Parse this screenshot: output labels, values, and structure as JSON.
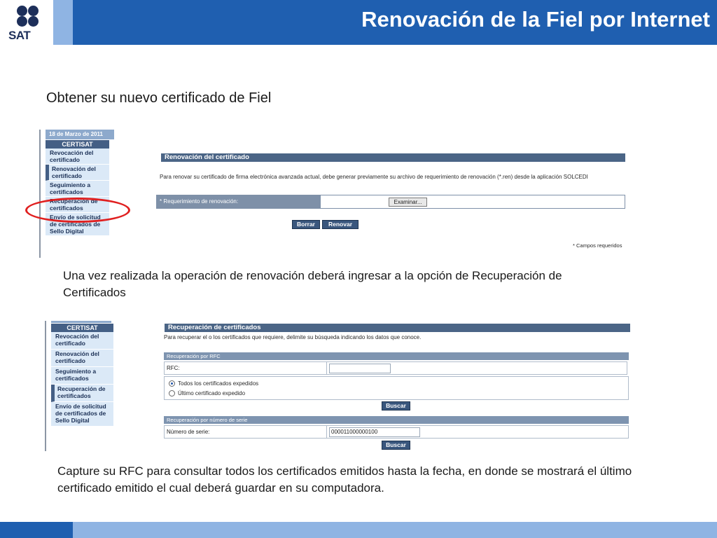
{
  "header": {
    "title": "Renovación de la Fiel por Internet",
    "logo_text": "SAT"
  },
  "subtitle": "Obtener su nuevo certificado de Fiel",
  "menu1": {
    "date": "18 de Marzo de 2011",
    "heading": "CERTISAT",
    "items": [
      {
        "label": "Revocación del certificado"
      },
      {
        "label": "Renovación del certificado"
      },
      {
        "label": "Seguimiento a certificados"
      },
      {
        "label": "Recuperación de certificados"
      },
      {
        "label": "Envío de solicitud de certificados de Sello Digital"
      }
    ]
  },
  "renovacion": {
    "title": "Renovación del certificado",
    "description": "Para renovar su certificado de firma electrónica avanzada actual, debe generar previamente su archivo de requerimiento de renovación (*.ren) desde la aplicación SOLCEDI",
    "field_label": "* Requerimiento de renovación:",
    "browse_label": "Examinar...",
    "delete_label": "Borrar",
    "renew_label": "Renovar",
    "required_note": "* Campos requeridos"
  },
  "paragraph1": "Una vez realizada la operación de renovación deberá ingresar a la opción de Recuperación de Certificados",
  "menu2": {
    "heading": "CERTISAT",
    "items": [
      {
        "label": "Revocación del certificado"
      },
      {
        "label": "Renovación del certificado"
      },
      {
        "label": "Seguimiento a certificados"
      },
      {
        "label": "Recuperación de certificados"
      },
      {
        "label": "Envío de solicitud de certificados de Sello Digital"
      }
    ]
  },
  "recuperacion": {
    "title": "Recuperación de certificados",
    "description": "Para recuperar el o los certificados que requiere, delimite su búsqueda indicando los datos que conoce.",
    "rfc_section": "Recuperación por RFC",
    "rfc_label": "RFC:",
    "rfc_value": "",
    "option_all": "Todos los certificados expedidos",
    "option_last": "Último certificado expedido",
    "search_label": "Buscar",
    "serial_section": "Recuperación por número de serie",
    "serial_label": "Número de serie:",
    "serial_value": "00001100000010​0",
    "search_label2": "Buscar"
  },
  "paragraph2": "Capture su RFC para consultar todos los certificados emitidos hasta la fecha, en donde se mostrará el último certificado emitido el cual deberá guardar en su computadora."
}
